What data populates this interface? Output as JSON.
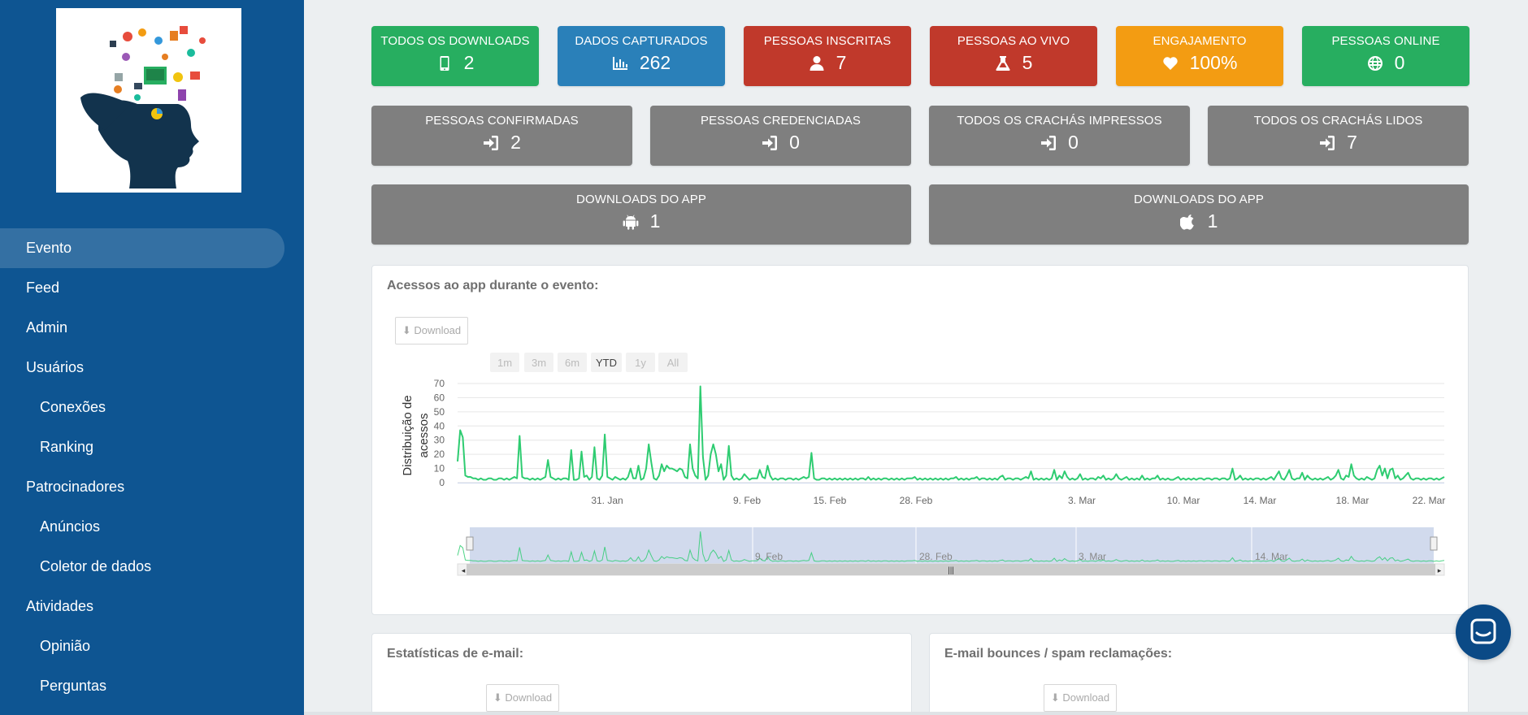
{
  "nav": {
    "items": [
      {
        "label": "Evento",
        "sub": false,
        "active": true
      },
      {
        "label": "Feed",
        "sub": false,
        "active": false
      },
      {
        "label": "Admin",
        "sub": false,
        "active": false
      },
      {
        "label": "Usuários",
        "sub": false,
        "active": false
      },
      {
        "label": "Conexões",
        "sub": true,
        "active": false
      },
      {
        "label": "Ranking",
        "sub": true,
        "active": false
      },
      {
        "label": "Patrocinadores",
        "sub": false,
        "active": false
      },
      {
        "label": "Anúncios",
        "sub": true,
        "active": false
      },
      {
        "label": "Coletor de dados",
        "sub": true,
        "active": false
      },
      {
        "label": "Atividades",
        "sub": false,
        "active": false
      },
      {
        "label": "Opinião",
        "sub": true,
        "active": false
      },
      {
        "label": "Perguntas",
        "sub": true,
        "active": false
      }
    ]
  },
  "stats_row1": [
    {
      "label": "TODOS OS DOWNLOADS",
      "value": "2",
      "icon": "mobile-icon",
      "color": "#27ae60"
    },
    {
      "label": "DADOS CAPTURADOS",
      "value": "262",
      "icon": "bar-chart-icon",
      "color": "#2a80b9"
    },
    {
      "label": "PESSOAS INSCRITAS",
      "value": "7",
      "icon": "user-icon",
      "color": "#c0392b"
    },
    {
      "label": "PESSOAS AO VIVO",
      "value": "5",
      "icon": "flask-icon",
      "color": "#c0392b"
    },
    {
      "label": "ENGAJAMENTO",
      "value": "100%",
      "icon": "heart-icon",
      "color": "#f39c12"
    },
    {
      "label": "PESSOAS ONLINE",
      "value": "0",
      "icon": "globe-icon",
      "color": "#27ae60"
    }
  ],
  "stats_row2": [
    {
      "label": "PESSOAS CONFIRMADAS",
      "value": "2",
      "icon": "sign-in-icon"
    },
    {
      "label": "PESSOAS CREDENCIADAS",
      "value": "0",
      "icon": "sign-in-icon"
    },
    {
      "label": "TODOS OS CRACHÁS IMPRESSOS",
      "value": "0",
      "icon": "sign-in-icon"
    },
    {
      "label": "TODOS OS CRACHÁS LIDOS",
      "value": "7",
      "icon": "sign-in-icon"
    }
  ],
  "stats_row3": [
    {
      "label": "DOWNLOADS DO APP",
      "value": "1",
      "icon": "android-icon"
    },
    {
      "label": "DOWNLOADS DO APP",
      "value": "1",
      "icon": "apple-icon"
    }
  ],
  "access_panel": {
    "title": "Acessos ao app durante o evento:",
    "download_label": "⬇ Download",
    "range_buttons": [
      "1m",
      "3m",
      "6m",
      "YTD",
      "1y",
      "All"
    ],
    "selected_range": "YTD"
  },
  "email_panel": {
    "title": "Estatísticas de e-mail:",
    "download_label": "⬇ Download"
  },
  "bounce_panel": {
    "title": "E-mail bounces / spam reclamações:",
    "download_label": "⬇ Download"
  },
  "chart_data": {
    "type": "line",
    "ylabel_line1": "Distribuição de",
    "ylabel_line2": "acessos",
    "ylim": [
      0,
      70
    ],
    "yticks": [
      0,
      10,
      20,
      30,
      40,
      50,
      60,
      70
    ],
    "xtick_labels": [
      "31. Jan",
      "9. Feb",
      "15. Feb",
      "28. Feb",
      "3. Mar",
      "10. Mar",
      "14. Mar",
      "18. Mar",
      "22. Mar"
    ],
    "navigator_labels": [
      "9. Feb",
      "28. Feb",
      "3. Mar",
      "14. Mar"
    ],
    "grid": true,
    "series": [
      {
        "color": "#2ecc71",
        "values": [
          15,
          37,
          32,
          5,
          4,
          4,
          3,
          3,
          2,
          3,
          2,
          2,
          3,
          3,
          2,
          2,
          3,
          3,
          2,
          3,
          2,
          3,
          4,
          3,
          33,
          4,
          3,
          3,
          2,
          3,
          2,
          3,
          2,
          3,
          4,
          16,
          4,
          3,
          2,
          3,
          2,
          3,
          3,
          2,
          23,
          2,
          2,
          3,
          22,
          4,
          5,
          2,
          4,
          25,
          3,
          2,
          5,
          34,
          4,
          3,
          2,
          4,
          3,
          2,
          3,
          2,
          4,
          10,
          3,
          3,
          12,
          2,
          3,
          10,
          27,
          14,
          3,
          2,
          5,
          13,
          8,
          12,
          10,
          10,
          9,
          8,
          10,
          9,
          4,
          3,
          27,
          10,
          5,
          3,
          68,
          18,
          2,
          5,
          20,
          27,
          20,
          8,
          13,
          2,
          5,
          26,
          5,
          2,
          3,
          2,
          3,
          6,
          4,
          2,
          3,
          3,
          3,
          9,
          4,
          3,
          12,
          5,
          2,
          3,
          2,
          3,
          3,
          2,
          3,
          3,
          2,
          3,
          2,
          3,
          4,
          3,
          4,
          21,
          3,
          2,
          2,
          3,
          3,
          2,
          3,
          2,
          3,
          2,
          3,
          2,
          3,
          2,
          3,
          2,
          3,
          2,
          3,
          3,
          2,
          4,
          2,
          3,
          2,
          3,
          2,
          3,
          3,
          2,
          3,
          2,
          3,
          2,
          3,
          2,
          3,
          3,
          3,
          4,
          2,
          3,
          2,
          3,
          2,
          3,
          2,
          3,
          2,
          3,
          2,
          3,
          2,
          3,
          3,
          4,
          2,
          3,
          2,
          3,
          2,
          3,
          3,
          4,
          2,
          3,
          3,
          2,
          3,
          2,
          3,
          2,
          4,
          5,
          2,
          3,
          3,
          2,
          3,
          3,
          2,
          3,
          4,
          3,
          8,
          2,
          3,
          2,
          3,
          2,
          3,
          2,
          3,
          9,
          2,
          5,
          3,
          8,
          4,
          2,
          3,
          2,
          3,
          6,
          2,
          3,
          2,
          3,
          3,
          2,
          4,
          3,
          5,
          2,
          3,
          2,
          3,
          6,
          3,
          2,
          3,
          4,
          2,
          3,
          2,
          3,
          2,
          5,
          2,
          3,
          2,
          3,
          3,
          5,
          2,
          3,
          2,
          3,
          2,
          2,
          3,
          4,
          2,
          3,
          2,
          3,
          2,
          3,
          2,
          3,
          3,
          2,
          3,
          3,
          2,
          3,
          3,
          2,
          3,
          3,
          2,
          3,
          10,
          2,
          3,
          5,
          2,
          3,
          2,
          3,
          2,
          3,
          3,
          2,
          3,
          2,
          3,
          4,
          2,
          5,
          8,
          3,
          2,
          5,
          9,
          3,
          2,
          3,
          3,
          7,
          2,
          5,
          3,
          2,
          3,
          2,
          3,
          2,
          3,
          4,
          2,
          3,
          5,
          9,
          3,
          2,
          5,
          4,
          13,
          5,
          3,
          2,
          3,
          2,
          4,
          3,
          2,
          3,
          9,
          12,
          5,
          10,
          3,
          9,
          10,
          3,
          5,
          2,
          3,
          5,
          7,
          3,
          2,
          3,
          3,
          2,
          3,
          2,
          3,
          3,
          2,
          3,
          2,
          3,
          4
        ]
      }
    ]
  }
}
